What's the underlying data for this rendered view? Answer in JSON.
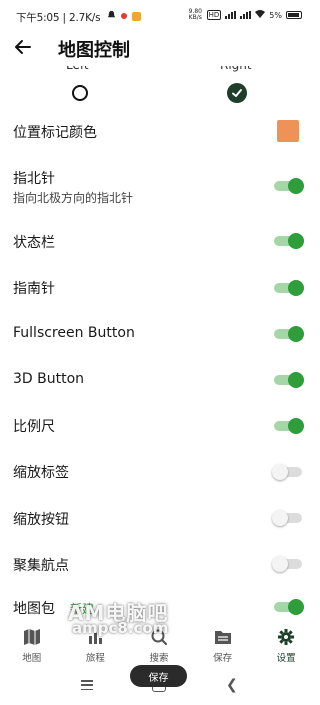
{
  "status_bar": {
    "time": "下午5:05 | 2.7K/s",
    "net_speed": "9.80 KB/s",
    "battery": "5%"
  },
  "header": {
    "title": "地图控制"
  },
  "position_row": {
    "left_label": "Left",
    "right_label": "Right",
    "selected": "Right"
  },
  "settings": {
    "marker_color": {
      "label": "位置标记颜色",
      "color": "#ef9259"
    },
    "north_arrow": {
      "label": "指北针",
      "sublabel": "指向北极方向的指北针",
      "enabled": true
    },
    "status_bar_toggle": {
      "label": "状态栏",
      "enabled": true
    },
    "compass": {
      "label": "指南针",
      "enabled": true
    },
    "fullscreen_button": {
      "label": "Fullscreen Button",
      "enabled": true
    },
    "three_d_button": {
      "label": "3D Button",
      "enabled": true
    },
    "scale_bar": {
      "label": "比例尺",
      "enabled": true
    },
    "zoom_labels": {
      "label": "缩放标签",
      "enabled": false
    },
    "zoom_buttons": {
      "label": "缩放按钮",
      "enabled": false
    },
    "cluster_waypoints": {
      "label": "聚集航点",
      "enabled": false
    },
    "map_pack": {
      "label": "地图包",
      "badge": "新建",
      "enabled": true
    }
  },
  "bottom_nav": {
    "items": [
      {
        "label": "地图",
        "icon": "map-icon"
      },
      {
        "label": "旅程",
        "icon": "journey-icon"
      },
      {
        "label": "搜索",
        "icon": "search-icon"
      },
      {
        "label": "保存",
        "icon": "folder-icon"
      },
      {
        "label": "设置",
        "icon": "gear-icon",
        "active": true
      }
    ]
  },
  "watermark": {
    "title": "AM电脑吧",
    "url": "ampc8.com"
  },
  "toast": {
    "text": "保存"
  },
  "colors": {
    "accent_green": "#2e9d3a",
    "toggle_track_on": "#a5d6a7",
    "dark_green": "#1f3d2b",
    "swatch_orange": "#ef9259"
  }
}
